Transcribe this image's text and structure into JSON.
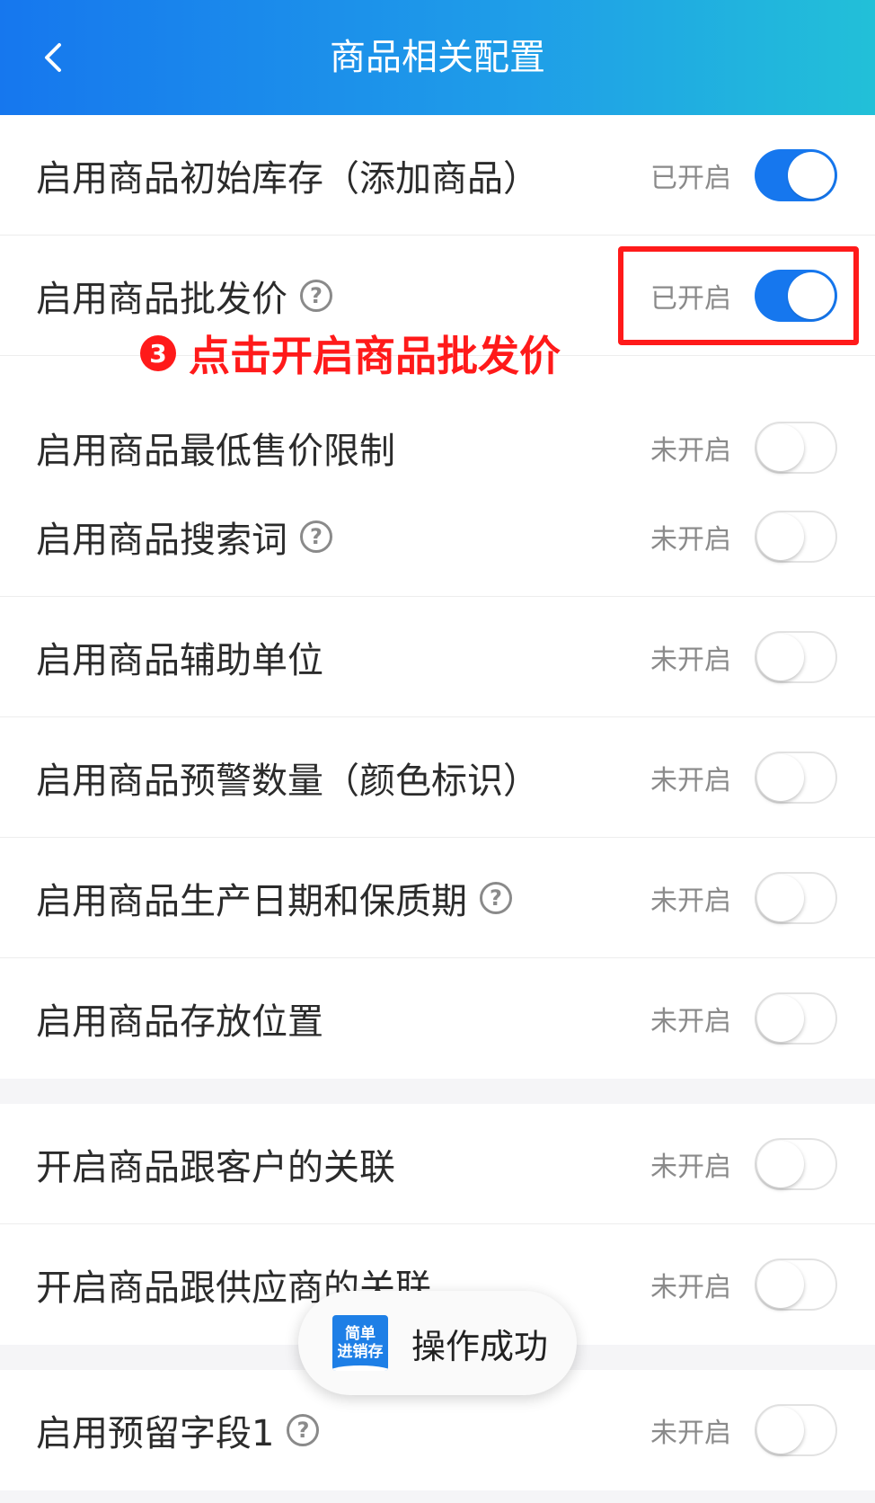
{
  "header": {
    "title": "商品相关配置"
  },
  "annotation": {
    "number": "3",
    "text": "点击开启商品批发价"
  },
  "rows_group1": [
    {
      "label": "启用商品初始库存（添加商品）",
      "help": false,
      "status": "已开启",
      "on": true
    },
    {
      "label": "启用商品批发价",
      "help": true,
      "status": "已开启",
      "on": true
    },
    {
      "label": "启用商品最低售价限制",
      "help": false,
      "status": "未开启",
      "on": false
    },
    {
      "label": "启用商品搜索词",
      "help": true,
      "status": "未开启",
      "on": false
    },
    {
      "label": "启用商品辅助单位",
      "help": false,
      "status": "未开启",
      "on": false
    },
    {
      "label": "启用商品预警数量（颜色标识）",
      "help": false,
      "status": "未开启",
      "on": false
    },
    {
      "label": "启用商品生产日期和保质期",
      "help": true,
      "status": "未开启",
      "on": false
    },
    {
      "label": "启用商品存放位置",
      "help": false,
      "status": "未开启",
      "on": false
    }
  ],
  "rows_group2": [
    {
      "label": "开启商品跟客户的关联",
      "help": false,
      "status": "未开启",
      "on": false
    },
    {
      "label": "开启商品跟供应商的关联",
      "help": false,
      "status": "未开启",
      "on": false
    }
  ],
  "rows_group3": [
    {
      "label": "启用预留字段1",
      "help": true,
      "status": "未开启",
      "on": false
    }
  ],
  "toast": {
    "logo_line1": "简单",
    "logo_line2": "进销存",
    "message": "操作成功"
  },
  "colors": {
    "accent": "#1677ee",
    "annotation": "#ff1a1a"
  }
}
